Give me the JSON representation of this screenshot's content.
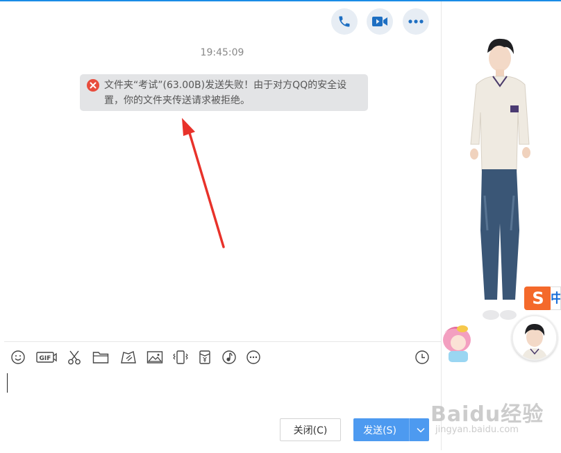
{
  "header": {
    "call_icon": "phone-icon",
    "video_icon": "video-camera-icon",
    "more_icon": "more-dots-icon"
  },
  "messages": {
    "timestamp": "19:45:09",
    "error_text": "文件夹“考试”(63.00B)发送失败！由于对方QQ的安全设置，你的文件夹传送请求被拒绝。",
    "error_color": "#e84c3d"
  },
  "toolbar": {
    "icons": [
      "emoji-icon",
      "gif-icon",
      "scissors-icon",
      "folder-icon",
      "screenshot-edit-icon",
      "image-icon",
      "shake-icon",
      "red-packet-icon",
      "music-icon",
      "more-icon"
    ],
    "history_icon": "clock-icon",
    "gif_label": "GIF"
  },
  "buttons": {
    "close_label": "关闭(C)",
    "send_label": "发送(S)",
    "send_color": "#4d9af0"
  },
  "sidebar": {
    "ime_label": "S",
    "ime_tail": "中"
  },
  "watermark": {
    "main": "Baidu经验",
    "sub": "jingyan.baidu.com"
  },
  "colors": {
    "accent": "#1a8ce6",
    "arrow": "#e8322a"
  }
}
